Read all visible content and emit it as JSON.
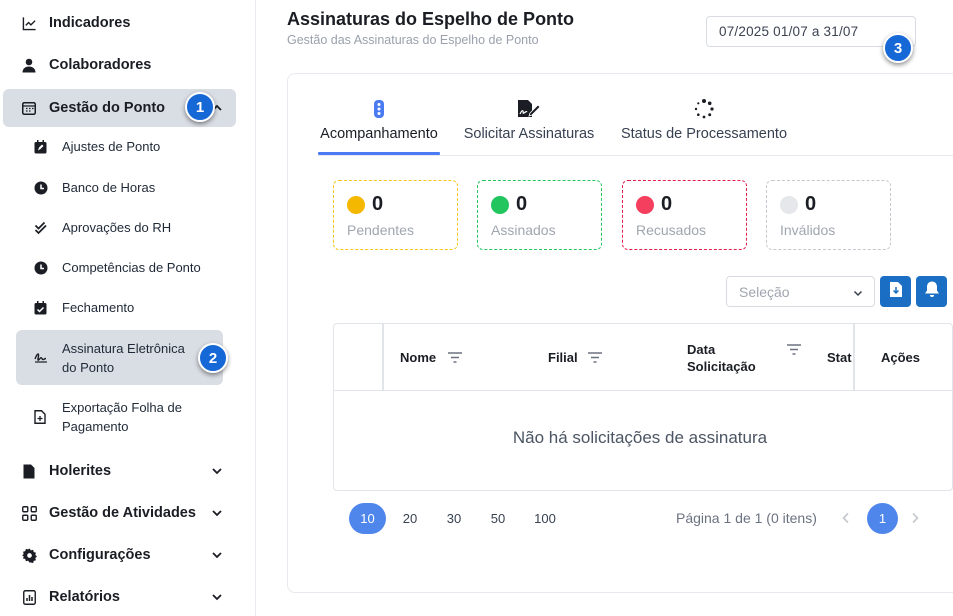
{
  "sidebar": {
    "items": [
      {
        "label": "Indicadores",
        "icon": "chart-line-icon"
      },
      {
        "label": "Colaboradores",
        "icon": "user-icon"
      },
      {
        "label": "Gestão do Ponto",
        "icon": "calendar-grid-icon"
      },
      {
        "label": "Holerites",
        "icon": "document-icon"
      },
      {
        "label": "Gestão de Atividades",
        "icon": "grid-apps-icon"
      },
      {
        "label": "Configurações",
        "icon": "gear-icon"
      },
      {
        "label": "Relatórios",
        "icon": "report-icon"
      }
    ],
    "subitems": [
      {
        "label": "Ajustes de Ponto",
        "icon": "calendar-edit-icon"
      },
      {
        "label": "Banco de Horas",
        "icon": "clock-icon"
      },
      {
        "label": "Aprovações do RH",
        "icon": "double-check-icon"
      },
      {
        "label": "Competências de Ponto",
        "icon": "clock-icon"
      },
      {
        "label": "Fechamento",
        "icon": "calendar-check-icon"
      },
      {
        "label": "Assinatura Eletrônica do Ponto",
        "icon": "signature-icon"
      },
      {
        "label": "Exportação Folha de Pagamento",
        "icon": "file-export-icon"
      }
    ]
  },
  "badges": [
    "1",
    "2",
    "3"
  ],
  "header": {
    "title": "Assinaturas do Espelho de Ponto",
    "subtitle": "Gestão das Assinaturas do Espelho de Ponto",
    "date_range": "07/2025  01/07 a 31/07"
  },
  "tabs": [
    {
      "label": "Acompanhamento",
      "icon": "status-dots-icon"
    },
    {
      "label": "Solicitar Assinaturas",
      "icon": "document-signature-icon"
    },
    {
      "label": "Status de Processamento",
      "icon": "spinner-icon"
    }
  ],
  "stats": [
    {
      "count": "0",
      "label": "Pendentes",
      "color": "#f5b800",
      "border": "#f5c518"
    },
    {
      "count": "0",
      "label": "Assinados",
      "color": "#22c55e",
      "border": "#22c55e"
    },
    {
      "count": "0",
      "label": "Recusados",
      "color": "#f43f5e",
      "border": "#e11d48"
    },
    {
      "count": "0",
      "label": "Inválidos",
      "color": "#e5e7eb",
      "border": "#c4c8ce"
    }
  ],
  "filter": {
    "placeholder": "Seleção"
  },
  "table": {
    "columns": [
      "Nome",
      "Filial",
      "Data Solicitação",
      "Stat",
      "Ações"
    ],
    "empty_message": "Não há solicitações de assinatura"
  },
  "pagination": {
    "sizes": [
      "10",
      "20",
      "30",
      "50",
      "100"
    ],
    "info": "Página 1 de 1 (0 itens)",
    "current_page": "1"
  }
}
